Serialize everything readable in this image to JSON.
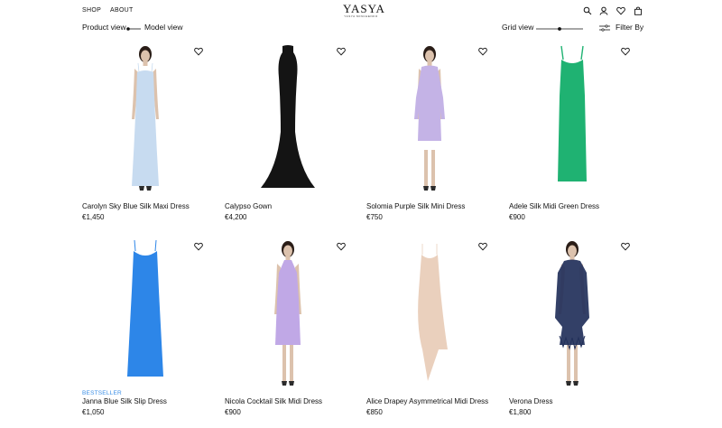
{
  "nav": {
    "shop": "SHOP",
    "about": "ABOUT"
  },
  "brand": {
    "name": "YASYA",
    "tagline": "YASYA MINCHENKO"
  },
  "toolbar": {
    "product_view": "Product view",
    "model_view": "Model view",
    "grid_view": "Grid view",
    "filter": "Filter By"
  },
  "grid_slider_level": 0.5,
  "products": [
    {
      "name": "Carolyn Sky Blue Silk Maxi Dress",
      "price": "€1,450",
      "badge": "",
      "color": "#c7dbf0",
      "style": "maxi-slip",
      "model": true
    },
    {
      "name": "Calypso Gown",
      "price": "€4,200",
      "badge": "",
      "color": "#141414",
      "style": "gown",
      "model": false
    },
    {
      "name": "Solomia Purple Silk Mini Dress",
      "price": "€750",
      "badge": "",
      "color": "#c4b3e6",
      "style": "mini-sleeve",
      "model": true
    },
    {
      "name": "Adele Silk Midi Green Dress",
      "price": "€900",
      "badge": "",
      "color": "#1fb272",
      "style": "midi-strap",
      "model": false
    },
    {
      "name": "Janna Blue Silk Slip Dress",
      "price": "€1,050",
      "badge": "BESTSELLER",
      "color": "#2d86e8",
      "style": "cowl-slip",
      "model": false
    },
    {
      "name": "Nicola Cocktail Silk Midi Dress",
      "price": "€900",
      "badge": "",
      "color": "#c0a8e6",
      "style": "halter-midi",
      "model": true
    },
    {
      "name": "Alice Drapey Asymmetrical Midi Dress",
      "price": "€850",
      "badge": "",
      "color": "#ead0bd",
      "style": "asym",
      "model": false
    },
    {
      "name": "Verona Dress",
      "price": "€1,800",
      "badge": "",
      "color": "#22305a",
      "style": "lace",
      "model": true
    }
  ],
  "colors": {
    "badge": "#3a8ee6",
    "text": "#111111",
    "skin": "#dcc2ad",
    "hair": "#2a1d17"
  }
}
